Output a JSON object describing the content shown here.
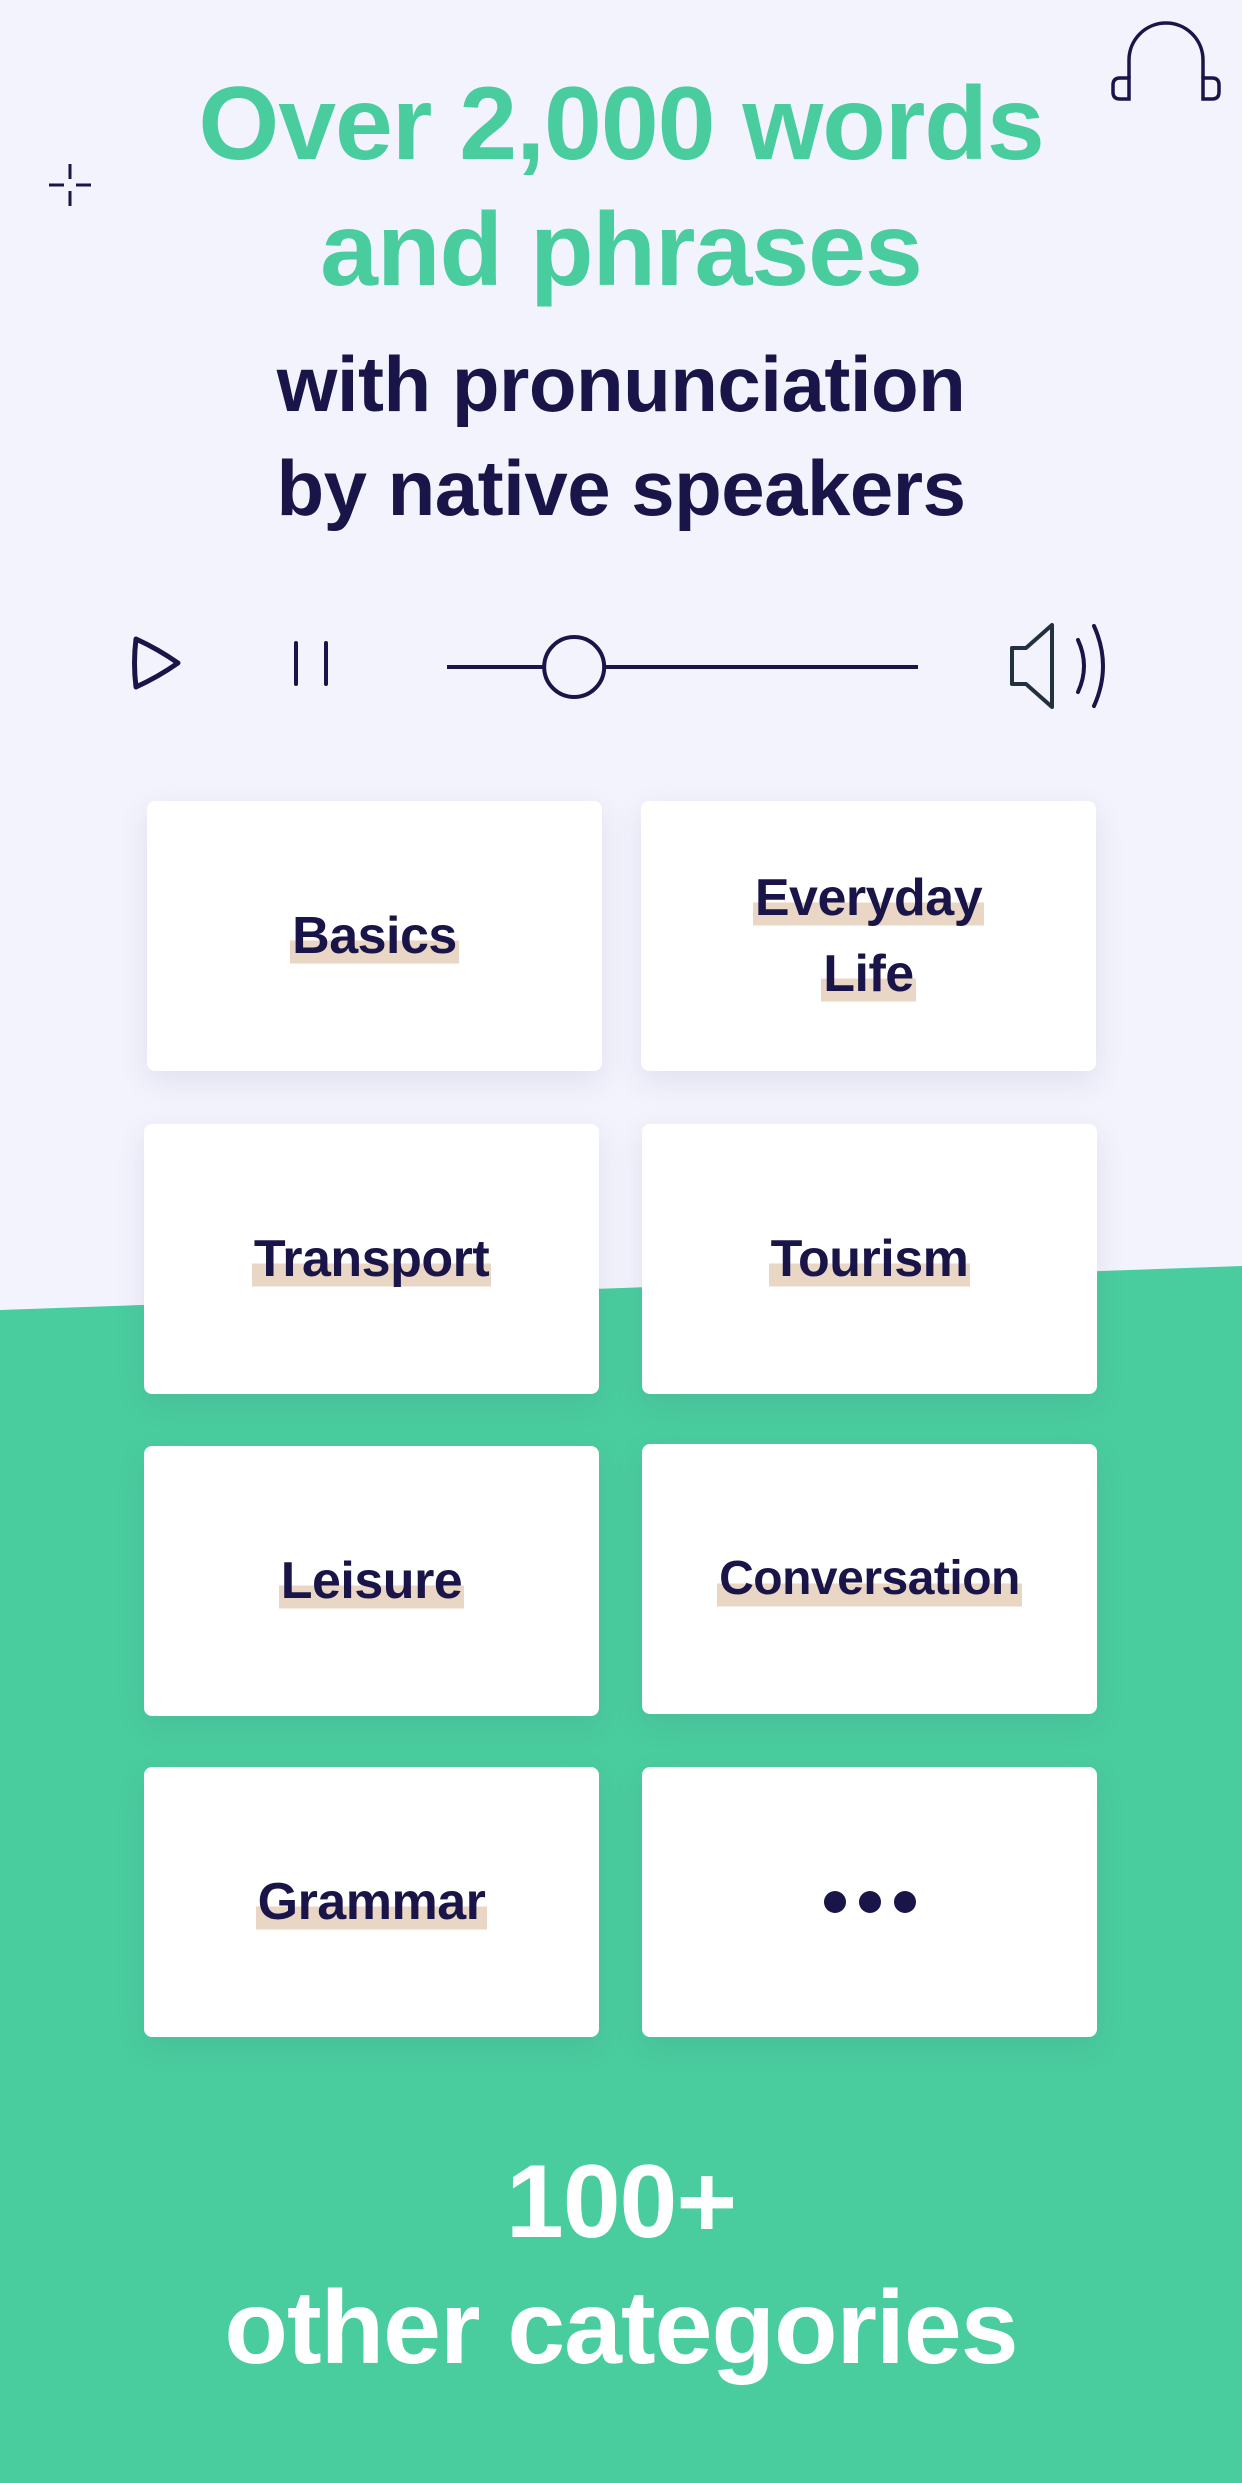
{
  "headline": {
    "line1": "Over 2,000 words",
    "line2": "and phrases",
    "line3": "with pronunciation",
    "line4": "by native speakers"
  },
  "player": {
    "play_icon": "play-icon",
    "pause_icon": "pause-icon",
    "volume_icon": "speaker-volume-icon",
    "progress": 0.27
  },
  "decorations": {
    "top_right_icon": "headphones-icon",
    "top_left_icon": "crosshair-icon"
  },
  "categories": [
    {
      "lines": [
        "Basics"
      ]
    },
    {
      "lines": [
        "Everyday",
        "Life"
      ]
    },
    {
      "lines": [
        "Transport"
      ]
    },
    {
      "lines": [
        "Tourism"
      ]
    },
    {
      "lines": [
        "Leisure"
      ]
    },
    {
      "lines": [
        "Conversation"
      ]
    },
    {
      "lines": [
        "Grammar"
      ]
    },
    {
      "more_icon": "more-dots-icon"
    }
  ],
  "footer": {
    "count": "100+",
    "text": "other categories"
  },
  "colors": {
    "accent_green": "#4acd9e",
    "navy": "#1a1548",
    "background": "#f3f3fd",
    "highlight": "#ead6c4",
    "card": "#ffffff"
  }
}
